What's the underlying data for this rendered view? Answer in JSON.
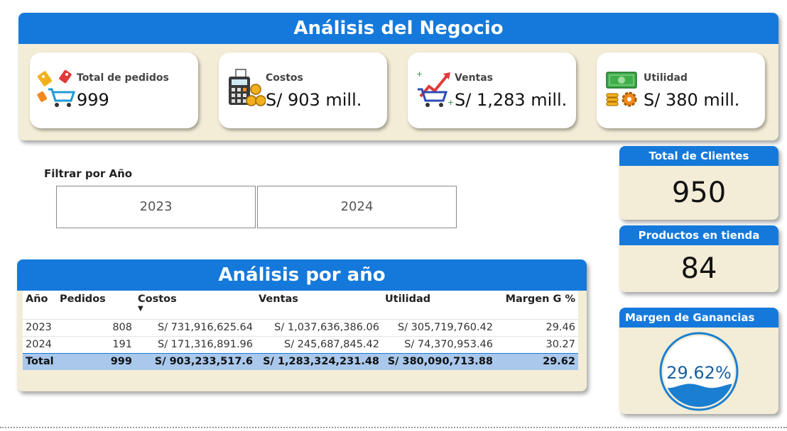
{
  "header": {
    "title": "Análisis del Negocio"
  },
  "kpis": [
    {
      "label": "Total de pedidos",
      "value": "999",
      "icon": "shopping-cart-tags-icon"
    },
    {
      "label": "Costos",
      "value": "S/ 903 mill.",
      "icon": "calculator-coins-icon"
    },
    {
      "label": "Ventas",
      "value": "S/ 1,283 mill.",
      "icon": "cart-growth-icon"
    },
    {
      "label": "Utilidad",
      "value": "S/ 380 mill.",
      "icon": "money-gear-icon"
    }
  ],
  "filter": {
    "title": "Filtrar por Año",
    "options": [
      "2023",
      "2024"
    ]
  },
  "table": {
    "title": "Análisis por año",
    "columns": [
      "Año",
      "Pedidos",
      "Costos",
      "Ventas",
      "Utilidad",
      "Margen G %"
    ],
    "rows": [
      [
        "2023",
        "808",
        "S/ 731,916,625.64",
        "S/ 1,037,636,386.06",
        "S/ 305,719,760.42",
        "29.46"
      ],
      [
        "2024",
        "191",
        "S/ 171,316,891.96",
        "S/ 245,687,845.42",
        "S/ 74,370,953.46",
        "30.27"
      ]
    ],
    "total": [
      "Total",
      "999",
      "S/ 903,233,517.6",
      "S/ 1,283,324,231.48",
      "S/ 380,090,713.88",
      "29.62"
    ]
  },
  "clients": {
    "title": "Total de Clientes",
    "value": "950"
  },
  "products": {
    "title": "Productos en tienda",
    "value": "84"
  },
  "margin": {
    "title": "Margen de Ganancias",
    "value": "29.62%",
    "fraction": 0.2962
  },
  "colors": {
    "accent": "#1479db",
    "panel_bg": "#f3ecd6",
    "total_row": "#a9c8ec",
    "water": "#1a7fd1"
  }
}
